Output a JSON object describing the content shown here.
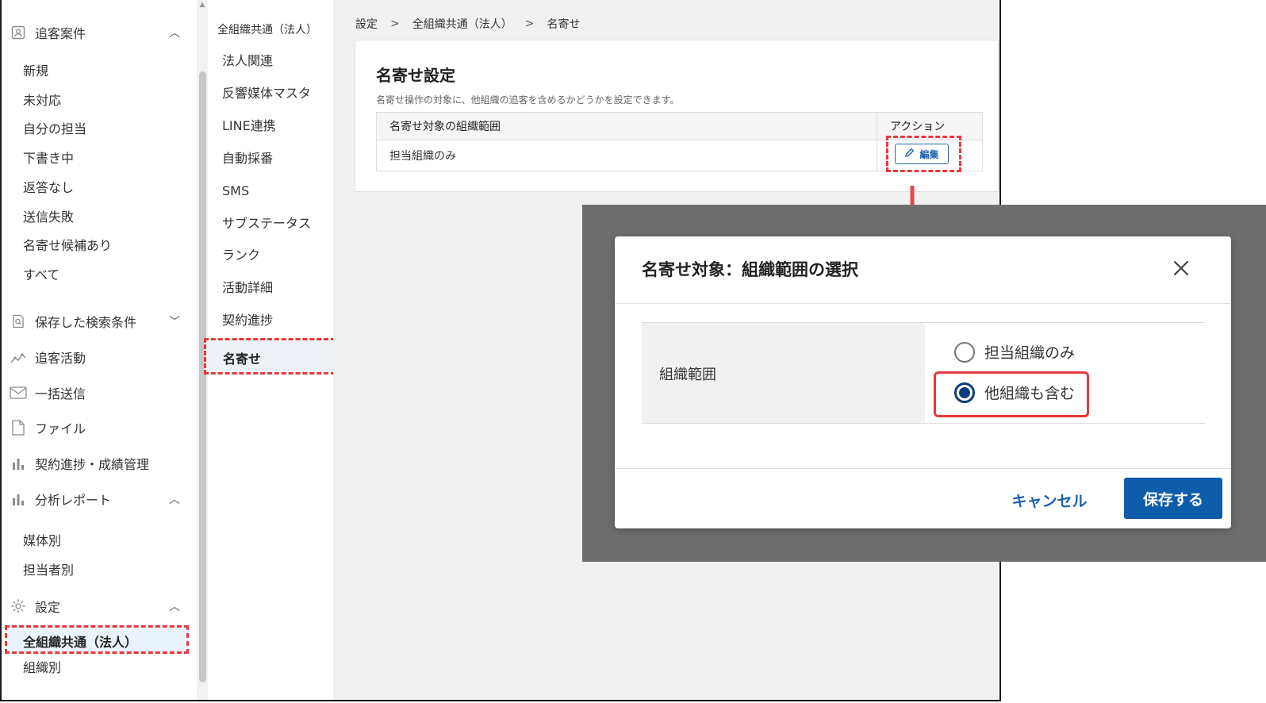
{
  "sidebar": {
    "groups": [
      {
        "label": "追客案件",
        "icon": "person-card-icon",
        "expanded": true
      },
      {
        "label": "保存した検索条件",
        "icon": "saved-search-icon",
        "expanded": false
      },
      {
        "label": "追客活動",
        "icon": "activity-chart-icon"
      },
      {
        "label": "一括送信",
        "icon": "mail-icon"
      },
      {
        "label": "ファイル",
        "icon": "file-icon"
      },
      {
        "label": "契約進捗・成績管理",
        "icon": "bar-chart-icon"
      },
      {
        "label": "分析レポート",
        "icon": "bar-chart-icon",
        "expanded": true
      },
      {
        "label": "設定",
        "icon": "gear-icon",
        "expanded": true
      }
    ],
    "case_items": [
      "新規",
      "未対応",
      "自分の担当",
      "下書き中",
      "返答なし",
      "送信失敗",
      "名寄せ候補あり",
      "すべて"
    ],
    "report_items": [
      "媒体別",
      "担当者別"
    ],
    "settings_items": [
      "全組織共通（法人）",
      "組織別"
    ],
    "selected": "全組織共通（法人）"
  },
  "subnav": {
    "title": "全組織共通（法人）",
    "items": [
      "法人関連",
      "反響媒体マスタ",
      "LINE連携",
      "自動採番",
      "SMS",
      "サブステータス",
      "ランク",
      "活動詳細",
      "契約進捗",
      "名寄せ"
    ],
    "selected": "名寄せ"
  },
  "breadcrumb": [
    "設定",
    "全組織共通（法人）",
    "名寄せ"
  ],
  "card": {
    "title": "名寄せ設定",
    "description": "名寄せ操作の対象に、他組織の追客を含めるかどうかを設定できます。",
    "table": {
      "headers": [
        "名寄せ対象の組織範囲",
        "アクション"
      ],
      "rows": [
        {
          "value": "担当組織のみ",
          "action": "編集"
        }
      ]
    }
  },
  "modal": {
    "title": "名寄せ対象：組織範囲の選択",
    "field_label": "組織範囲",
    "options": [
      {
        "label": "担当組織のみ",
        "checked": false
      },
      {
        "label": "他組織も含む",
        "checked": true
      }
    ],
    "cancel_label": "キャンセル",
    "save_label": "保存する"
  },
  "colors": {
    "accent": "#0f5cab",
    "highlight": "#e8383d",
    "overlay": "#6e6e6e"
  }
}
